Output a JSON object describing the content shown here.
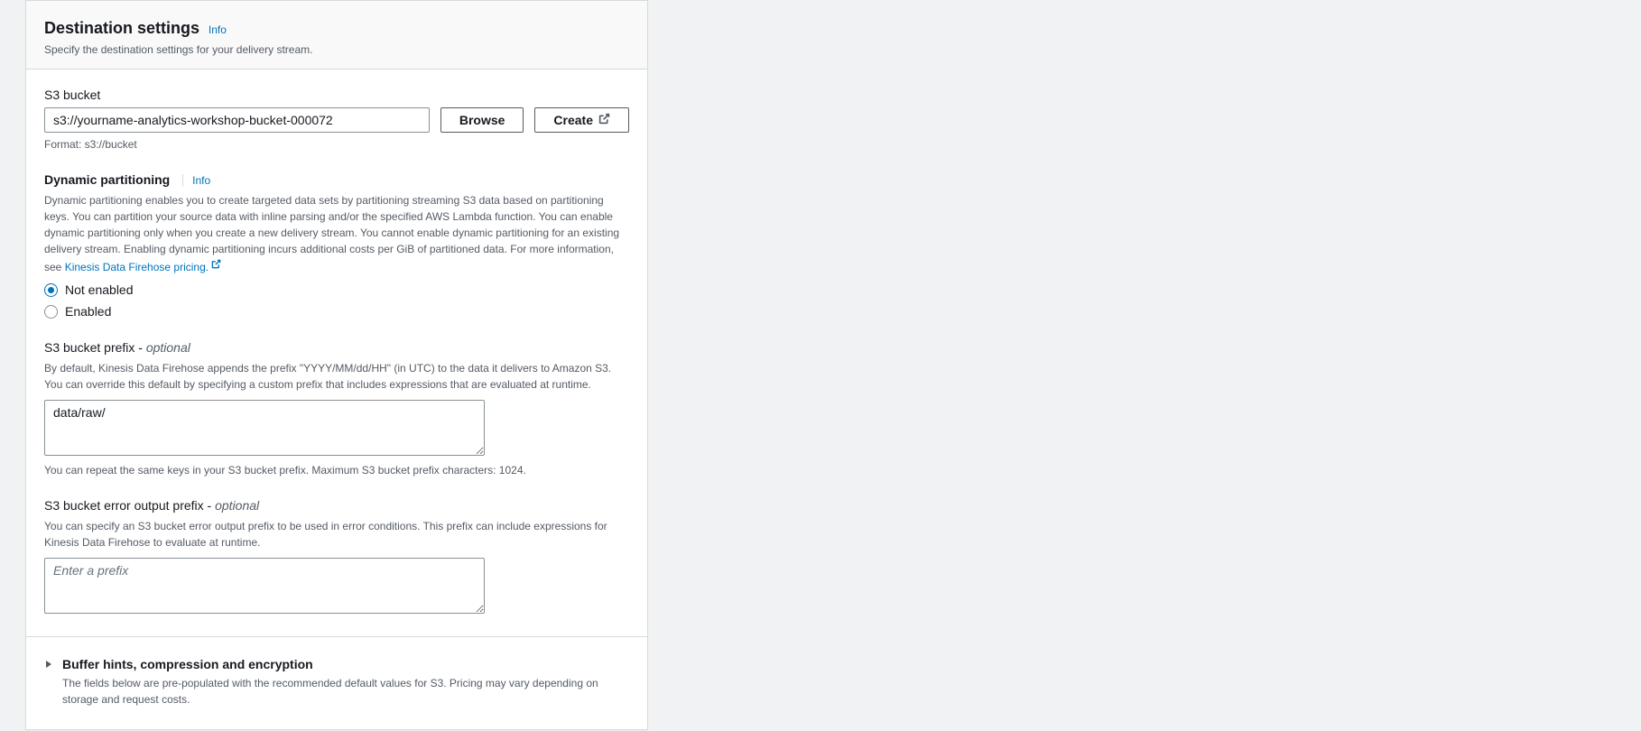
{
  "header": {
    "title": "Destination settings",
    "info": "Info",
    "subtitle": "Specify the destination settings for your delivery stream."
  },
  "s3bucket": {
    "label": "S3 bucket",
    "value": "s3://yourname-analytics-workshop-bucket-000072",
    "browse": "Browse",
    "create": "Create",
    "hint": "Format: s3://bucket"
  },
  "dynamic": {
    "title": "Dynamic partitioning",
    "info": "Info",
    "desc": "Dynamic partitioning enables you to create targeted data sets by partitioning streaming S3 data based on partitioning keys. You can partition your source data with inline parsing and/or the specified AWS Lambda function. You can enable dynamic partitioning only when you create a new delivery stream. You cannot enable dynamic partitioning for an existing delivery stream. Enabling dynamic partitioning incurs additional costs per GiB of partitioned data. For more information, see ",
    "pricing_link": "Kinesis Data Firehose pricing.",
    "not_enabled": "Not enabled",
    "enabled": "Enabled"
  },
  "prefix": {
    "label": "S3 bucket prefix - ",
    "optional": "optional",
    "desc": "By default, Kinesis Data Firehose appends the prefix \"YYYY/MM/dd/HH\" (in UTC) to the data it delivers to Amazon S3. You can override this default by specifying a custom prefix that includes expressions that are evaluated at runtime.",
    "value": "data/raw/",
    "hint": "You can repeat the same keys in your S3 bucket prefix. Maximum S3 bucket prefix characters: 1024."
  },
  "error_prefix": {
    "label": "S3 bucket error output prefix - ",
    "optional": "optional",
    "desc": "You can specify an S3 bucket error output prefix to be used in error conditions. This prefix can include expressions for Kinesis Data Firehose to evaluate at runtime.",
    "value": "",
    "placeholder": "Enter a prefix"
  },
  "buffer": {
    "title": "Buffer hints, compression and encryption",
    "desc": "The fields below are pre-populated with the recommended default values for S3. Pricing may vary depending on storage and request costs."
  }
}
